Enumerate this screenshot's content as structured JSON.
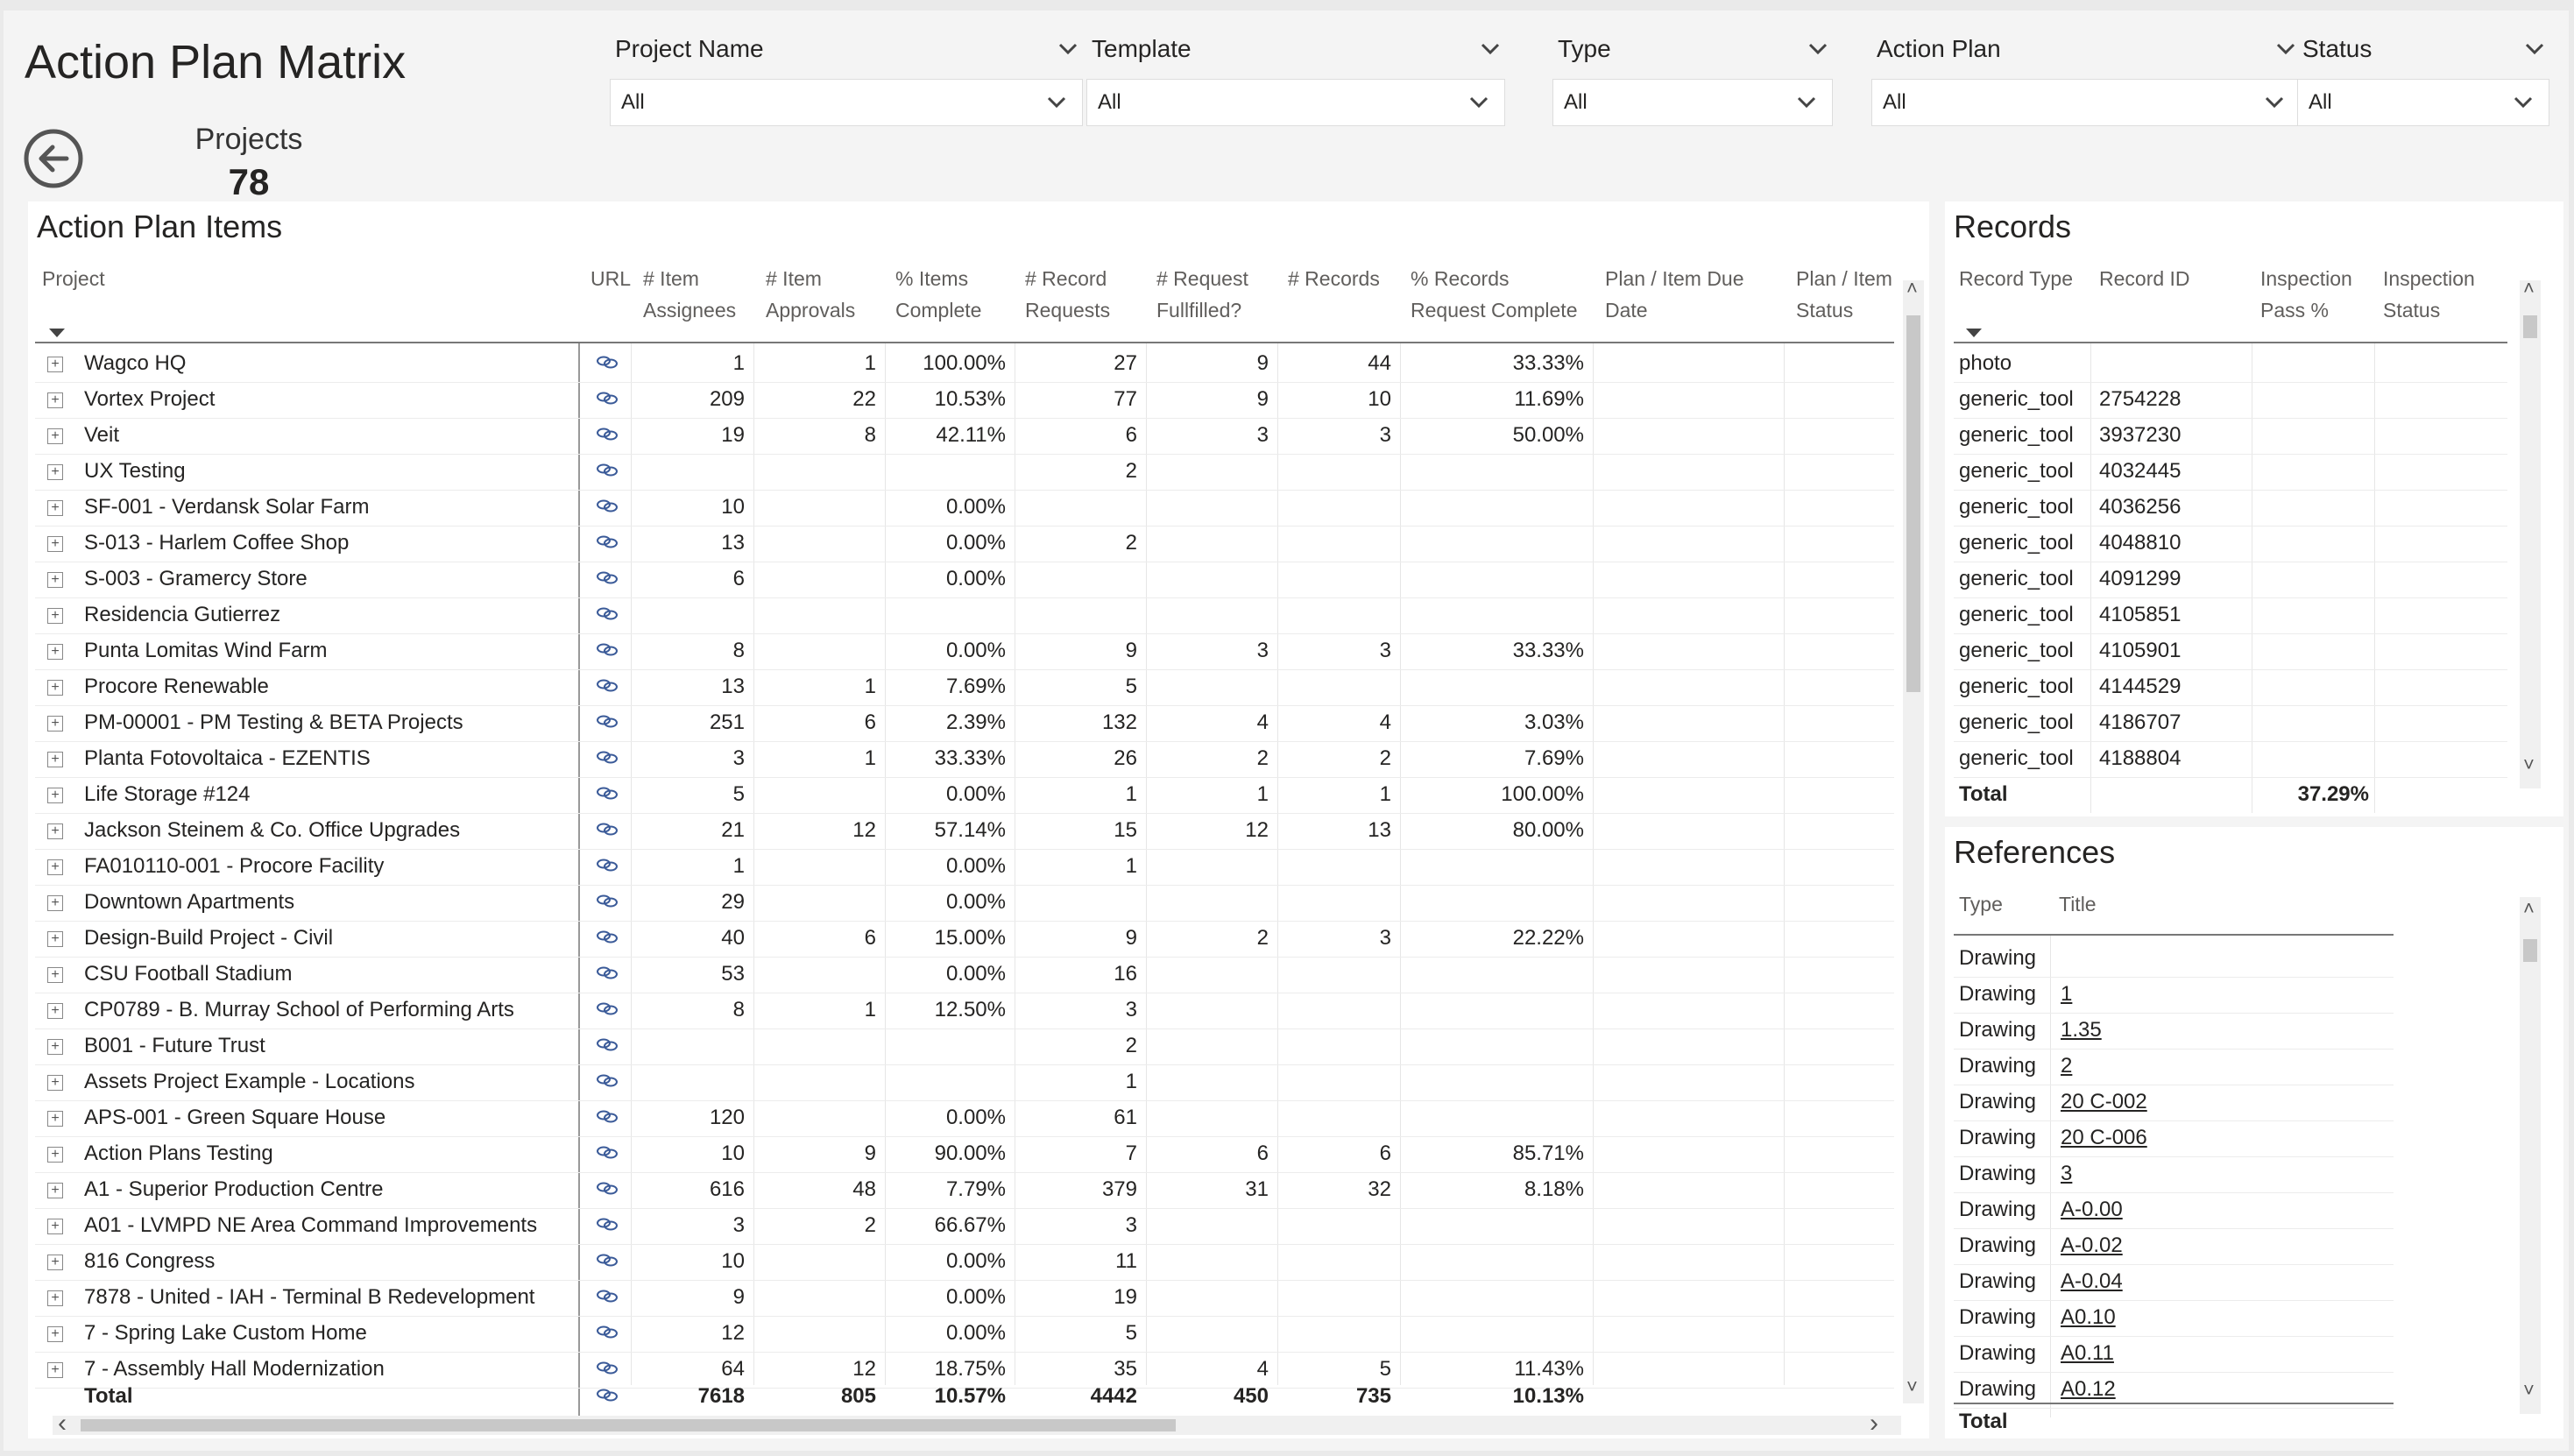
{
  "title": "Action Plan Matrix",
  "card": {
    "label": "Projects",
    "value": "78"
  },
  "slicers": [
    {
      "label": "Project Name",
      "value": "All"
    },
    {
      "label": "Template",
      "value": "All"
    },
    {
      "label": "Type",
      "value": "All"
    },
    {
      "label": "Action Plan",
      "value": "All"
    },
    {
      "label": "Status",
      "value": "All"
    }
  ],
  "action_items": {
    "title": "Action Plan Items",
    "columns": [
      [
        "Project",
        ""
      ],
      [
        "URL",
        ""
      ],
      [
        "# Item",
        "Assignees"
      ],
      [
        "# Item",
        "Approvals"
      ],
      [
        "% Items",
        "Complete"
      ],
      [
        "# Record",
        "Requests"
      ],
      [
        "# Request",
        "Fullfilled?"
      ],
      [
        "# Records",
        ""
      ],
      [
        "% Records",
        "Request Complete"
      ],
      [
        "Plan / Item Due",
        "Date"
      ],
      [
        "Plan / Item",
        "Status"
      ]
    ],
    "rows": [
      [
        "Wagco HQ",
        "1",
        "1",
        "100.00%",
        "27",
        "9",
        "44",
        "33.33%"
      ],
      [
        "Vortex Project",
        "209",
        "22",
        "10.53%",
        "77",
        "9",
        "10",
        "11.69%"
      ],
      [
        "Veit",
        "19",
        "8",
        "42.11%",
        "6",
        "3",
        "3",
        "50.00%"
      ],
      [
        "UX Testing",
        "",
        "",
        "",
        "2",
        "",
        "",
        ""
      ],
      [
        "SF-001 - Verdansk Solar Farm",
        "10",
        "",
        "0.00%",
        "",
        "",
        "",
        ""
      ],
      [
        "S-013 - Harlem Coffee Shop",
        "13",
        "",
        "0.00%",
        "2",
        "",
        "",
        ""
      ],
      [
        "S-003 - Gramercy Store",
        "6",
        "",
        "0.00%",
        "",
        "",
        "",
        ""
      ],
      [
        "Residencia Gutierrez",
        "",
        "",
        "",
        "",
        "",
        "",
        ""
      ],
      [
        "Punta Lomitas Wind Farm",
        "8",
        "",
        "0.00%",
        "9",
        "3",
        "3",
        "33.33%"
      ],
      [
        "Procore Renewable",
        "13",
        "1",
        "7.69%",
        "5",
        "",
        "",
        ""
      ],
      [
        "PM-00001 - PM Testing & BETA Projects",
        "251",
        "6",
        "2.39%",
        "132",
        "4",
        "4",
        "3.03%"
      ],
      [
        "Planta Fotovoltaica - EZENTIS",
        "3",
        "1",
        "33.33%",
        "26",
        "2",
        "2",
        "7.69%"
      ],
      [
        "Life Storage #124",
        "5",
        "",
        "0.00%",
        "1",
        "1",
        "1",
        "100.00%"
      ],
      [
        "Jackson Steinem & Co. Office Upgrades",
        "21",
        "12",
        "57.14%",
        "15",
        "12",
        "13",
        "80.00%"
      ],
      [
        "FA010110-001 - Procore Facility",
        "1",
        "",
        "0.00%",
        "1",
        "",
        "",
        ""
      ],
      [
        "Downtown Apartments",
        "29",
        "",
        "0.00%",
        "",
        "",
        "",
        ""
      ],
      [
        "Design-Build Project - Civil",
        "40",
        "6",
        "15.00%",
        "9",
        "2",
        "3",
        "22.22%"
      ],
      [
        "CSU Football Stadium",
        "53",
        "",
        "0.00%",
        "16",
        "",
        "",
        ""
      ],
      [
        "CP0789 - B. Murray School of Performing Arts",
        "8",
        "1",
        "12.50%",
        "3",
        "",
        "",
        ""
      ],
      [
        "B001 - Future Trust",
        "",
        "",
        "",
        "2",
        "",
        "",
        ""
      ],
      [
        "Assets Project Example - Locations",
        "",
        "",
        "",
        "1",
        "",
        "",
        ""
      ],
      [
        "APS-001 - Green Square House",
        "120",
        "",
        "0.00%",
        "61",
        "",
        "",
        ""
      ],
      [
        "Action Plans Testing",
        "10",
        "9",
        "90.00%",
        "7",
        "6",
        "6",
        "85.71%"
      ],
      [
        "A1 - Superior Production Centre",
        "616",
        "48",
        "7.79%",
        "379",
        "31",
        "32",
        "8.18%"
      ],
      [
        "A01 - LVMPD NE Area Command Improvements",
        "3",
        "2",
        "66.67%",
        "3",
        "",
        "",
        ""
      ],
      [
        "816 Congress",
        "10",
        "",
        "0.00%",
        "11",
        "",
        "",
        ""
      ],
      [
        "7878 - United - IAH - Terminal B Redevelopment",
        "9",
        "",
        "0.00%",
        "19",
        "",
        "",
        ""
      ],
      [
        "7 - Spring Lake Custom Home",
        "12",
        "",
        "0.00%",
        "5",
        "",
        "",
        ""
      ],
      [
        "7 - Assembly Hall Modernization",
        "64",
        "12",
        "18.75%",
        "35",
        "4",
        "5",
        "11.43%"
      ]
    ],
    "total": [
      "Total",
      "7618",
      "805",
      "10.57%",
      "4442",
      "450",
      "735",
      "10.13%"
    ]
  },
  "records": {
    "title": "Records",
    "columns": [
      [
        "Record Type",
        ""
      ],
      [
        "Record ID",
        ""
      ],
      [
        "Inspection",
        "Pass %"
      ],
      [
        "Inspection",
        "Status"
      ]
    ],
    "rows": [
      [
        "photo",
        ""
      ],
      [
        "generic_tool",
        "2754228"
      ],
      [
        "generic_tool",
        "3937230"
      ],
      [
        "generic_tool",
        "4032445"
      ],
      [
        "generic_tool",
        "4036256"
      ],
      [
        "generic_tool",
        "4048810"
      ],
      [
        "generic_tool",
        "4091299"
      ],
      [
        "generic_tool",
        "4105851"
      ],
      [
        "generic_tool",
        "4105901"
      ],
      [
        "generic_tool",
        "4144529"
      ],
      [
        "generic_tool",
        "4186707"
      ],
      [
        "generic_tool",
        "4188804"
      ]
    ],
    "total_label": "Total",
    "total_pass": "37.29%"
  },
  "references": {
    "title": "References",
    "columns": [
      "Type",
      "Title"
    ],
    "rows": [
      [
        "Drawing",
        ""
      ],
      [
        "Drawing",
        "1"
      ],
      [
        "Drawing",
        "1.35"
      ],
      [
        "Drawing",
        "2"
      ],
      [
        "Drawing",
        "20 C-002"
      ],
      [
        "Drawing",
        "20 C-006"
      ],
      [
        "Drawing",
        "3"
      ],
      [
        "Drawing",
        "A-0.00"
      ],
      [
        "Drawing",
        "A-0.02"
      ],
      [
        "Drawing",
        "A-0.04"
      ],
      [
        "Drawing",
        "A0.10"
      ],
      [
        "Drawing",
        "A0.11"
      ],
      [
        "Drawing",
        "A0.12"
      ]
    ],
    "total_label": "Total"
  }
}
